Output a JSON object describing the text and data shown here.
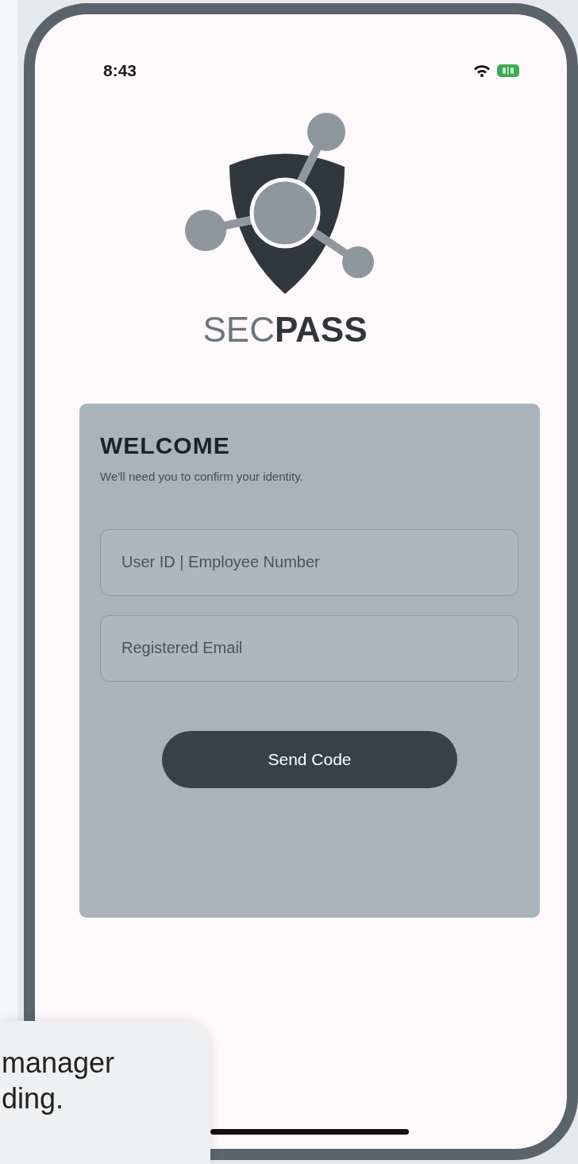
{
  "status_bar": {
    "time": "8:43"
  },
  "logo": {
    "wordmark": "SEC**PASS**"
  },
  "login_card": {
    "title": "WELCOME",
    "subtitle": "We'll need you to confirm your identity.",
    "fields": [
      {
        "placeholder": "User ID | Employee Number"
      },
      {
        "placeholder": "Registered Email"
      }
    ],
    "button": "Send Code"
  },
  "caption": {
    "lines": [
      "manager",
      "ding."
    ]
  }
}
